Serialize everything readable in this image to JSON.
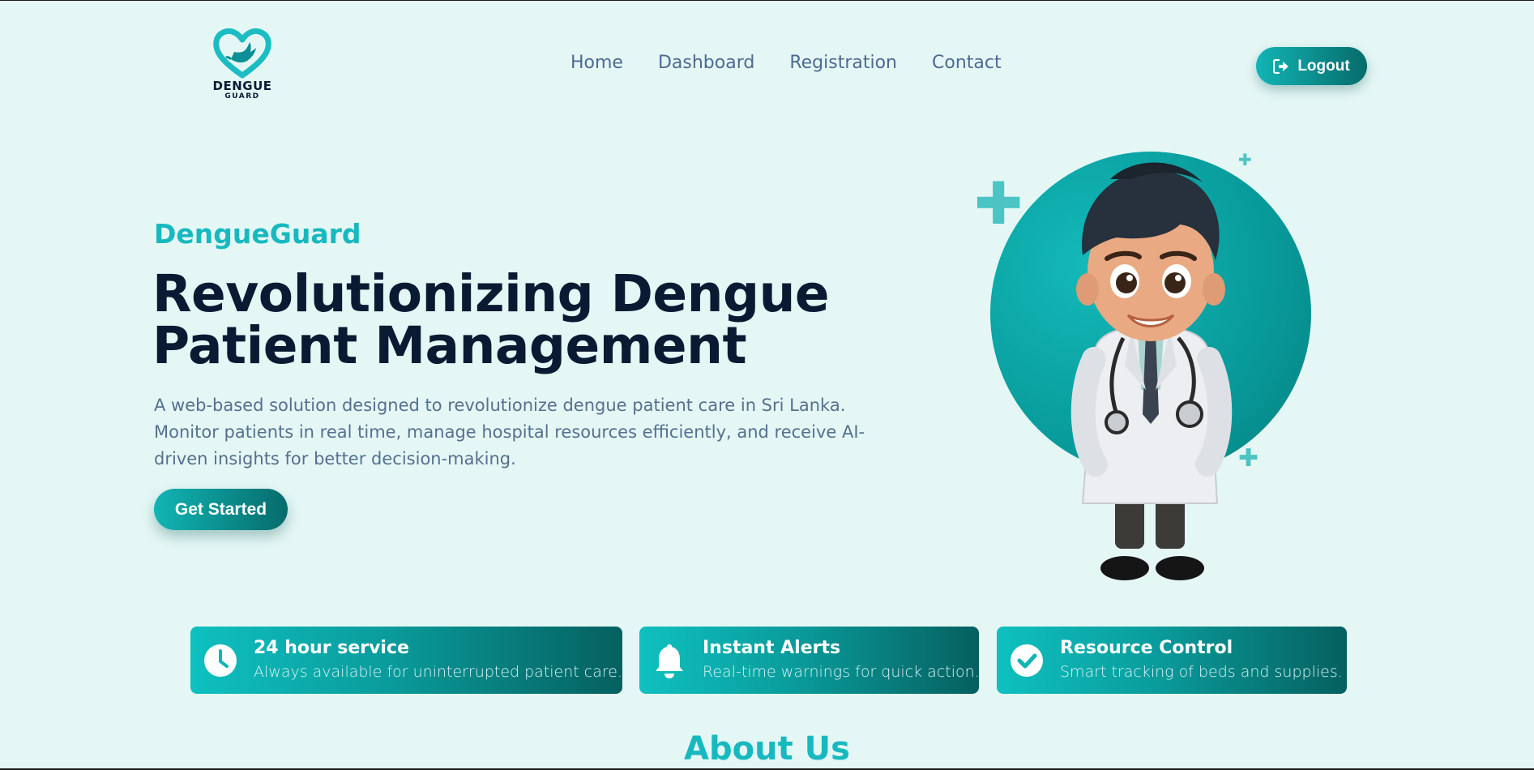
{
  "logo": {
    "line1": "DENGUE",
    "line2": "GUARD",
    "icon": "heart-hand-icon"
  },
  "nav": {
    "items": [
      {
        "label": "Home"
      },
      {
        "label": "Dashboard"
      },
      {
        "label": "Registration"
      },
      {
        "label": "Contact"
      }
    ]
  },
  "header": {
    "logout_label": "Logout",
    "logout_icon": "sign-out-icon"
  },
  "hero": {
    "brand": "DengueGuard",
    "headline_line1": "Revolutionizing Dengue",
    "headline_line2": "Patient Management",
    "lead": "A web-based solution designed to revolutionize dengue patient care in Sri Lanka. Monitor patients in real time, manage hospital resources efficiently, and receive AI-driven insights for better decision-making.",
    "cta_label": "Get Started",
    "illustration": "cartoon-doctor-illustration"
  },
  "features": [
    {
      "title": "24 hour service",
      "desc": "Always available for uninterrupted patient care.",
      "icon": "clock-icon"
    },
    {
      "title": "Instant Alerts",
      "desc": "Real-time warnings for quick action.",
      "icon": "bell-icon"
    },
    {
      "title": "Resource Control",
      "desc": "Smart tracking of beds and supplies.",
      "icon": "check-circle-icon"
    }
  ],
  "about": {
    "title": "About Us"
  },
  "colors": {
    "accent": "#17b9bf",
    "accent_dark": "#066b6b",
    "background": "#e4f7f5",
    "heading": "#0b1a33"
  }
}
